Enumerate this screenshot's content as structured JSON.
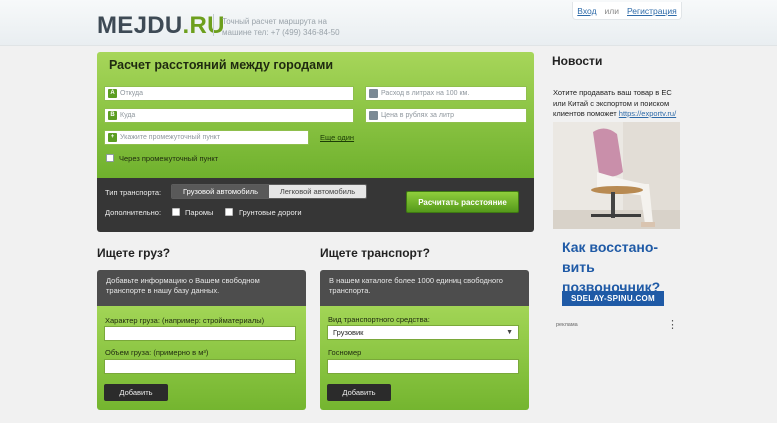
{
  "header": {
    "logo_part1": "MEJDU",
    "logo_part2": ".RU",
    "tagline": "Точный расчет маршрута на машине тел: +7 (499) 346-84-50",
    "login": "Вход",
    "or": "или",
    "register": "Регистрация"
  },
  "calculator": {
    "title": "Расчет расстояний между городами",
    "from_placeholder": "Откуда",
    "to_placeholder": "Куда",
    "via_placeholder": "Укажите промежуточный пункт",
    "add_more": "Еще один",
    "fuel_placeholder": "Расход в литрах на 100 км.",
    "price_placeholder": "Цена в рублях за литр",
    "via_checkbox": "Через промежуточный пункт",
    "transport_type_label": "Тип транспорта:",
    "truck": "Грузовой автомобиль",
    "car": "Легковой автомобиль",
    "extra_label": "Дополнительно:",
    "ferries": "Паромы",
    "dirt_roads": "Грунтовые дороги",
    "calc_button": "Расчитать расстояние",
    "icon_from": "A",
    "icon_to": "B",
    "icon_via": "+"
  },
  "cargo": {
    "title": "Ищете груз?",
    "info": "Добавьте информацию о Вашем свободном транспорте в нашу базу данных.",
    "char_label": "Характер груза: (например: стройматериалы)",
    "volume_label": "Объем груза: (примерно в м³)",
    "add_button": "Добавить"
  },
  "transport": {
    "title": "Ищете транспорт?",
    "info": "В нашем каталоге более 1000 единиц свободного транспорта.",
    "type_label": "Вид транспортного средства:",
    "type_value": "Грузовик",
    "plate_label": "Госномер",
    "add_button": "Добавить"
  },
  "news": {
    "title": "Новости",
    "text": "Хотите продавать ваш товар в ЕС или Китай с экспортом и поиском клиентов поможет",
    "link": "https://exportv.ru/"
  },
  "ad": {
    "headline": "Как восстано- вить позвоночник?",
    "url": "SDELAY-SPINU.COM",
    "label": "реклама"
  }
}
